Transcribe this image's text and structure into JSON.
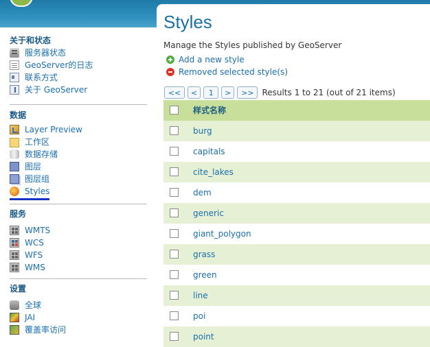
{
  "sidebar": {
    "sections": [
      {
        "title": "关于和状态",
        "items": [
          "服务器状态",
          "GeoServer的日志",
          "联系方式",
          "关于 GeoServer"
        ]
      },
      {
        "title": "数据",
        "items": [
          "Layer Preview",
          "工作区",
          "数据存储",
          "图层",
          "图层组",
          "Styles"
        ]
      },
      {
        "title": "服务",
        "items": [
          "WMTS",
          "WCS",
          "WFS",
          "WMS"
        ]
      },
      {
        "title": "设置",
        "items": [
          "全球",
          "JAI",
          "覆盖率访问"
        ]
      }
    ],
    "active_item": "Styles"
  },
  "main": {
    "title": "Styles",
    "description": "Manage the Styles published by GeoServer",
    "actions": {
      "add": "Add a new style",
      "remove": "Removed selected style(s)"
    },
    "pager": {
      "first": "<<",
      "prev": "<",
      "page": "1",
      "next": ">",
      "last": ">>",
      "results": "Results 1 to 21 (out of 21 items)"
    },
    "table": {
      "header": "样式名称",
      "rows": [
        "burg",
        "capitals",
        "cite_lakes",
        "dem",
        "generic",
        "giant_polygon",
        "grass",
        "green",
        "line",
        "poi",
        "point"
      ]
    }
  },
  "colors": {
    "header": "#2f8fbd",
    "accent": "#1a6fb0",
    "row_alt": "#e5f0d4",
    "table_head": "#c7df9b",
    "active_underline": "#1531c8"
  }
}
